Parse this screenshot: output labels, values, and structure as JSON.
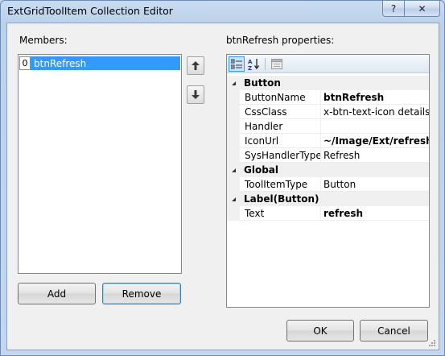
{
  "window": {
    "title": "ExtGridToolItem Collection Editor",
    "help_glyph": "?",
    "close_glyph": "✕"
  },
  "members": {
    "label": "Members:",
    "items": [
      {
        "index": "0",
        "name": "btnRefresh",
        "selected": true
      }
    ],
    "move_up_icon": "arrow-up-icon",
    "move_down_icon": "arrow-down-icon",
    "add_label": "Add",
    "remove_label": "Remove"
  },
  "properties": {
    "label": "btnRefresh properties:",
    "toolbar": [
      "categorized-icon",
      "alphabetical-icon",
      "property-pages-icon"
    ],
    "categories": [
      {
        "name": "Button",
        "rows": [
          {
            "name": "ButtonName",
            "value": "btnRefresh",
            "bold": true
          },
          {
            "name": "CssClass",
            "value": "x-btn-text-icon details",
            "bold": false
          },
          {
            "name": "Handler",
            "value": "",
            "bold": false
          },
          {
            "name": "IconUrl",
            "value": "~/Image/Ext/refresh.g",
            "bold": true
          },
          {
            "name": "SysHandlerType",
            "value": "Refresh",
            "bold": false
          }
        ]
      },
      {
        "name": "Global",
        "rows": [
          {
            "name": "ToolItemType",
            "value": "Button",
            "bold": false
          }
        ]
      },
      {
        "name": "Label(Button)",
        "rows": [
          {
            "name": "Text",
            "value": "refresh",
            "bold": true
          }
        ]
      }
    ]
  },
  "dialog": {
    "ok_label": "OK",
    "cancel_label": "Cancel"
  },
  "colors": {
    "selection": "#3399ff",
    "window_frame": "#bcd1ea",
    "client": "#f0f0f0"
  }
}
